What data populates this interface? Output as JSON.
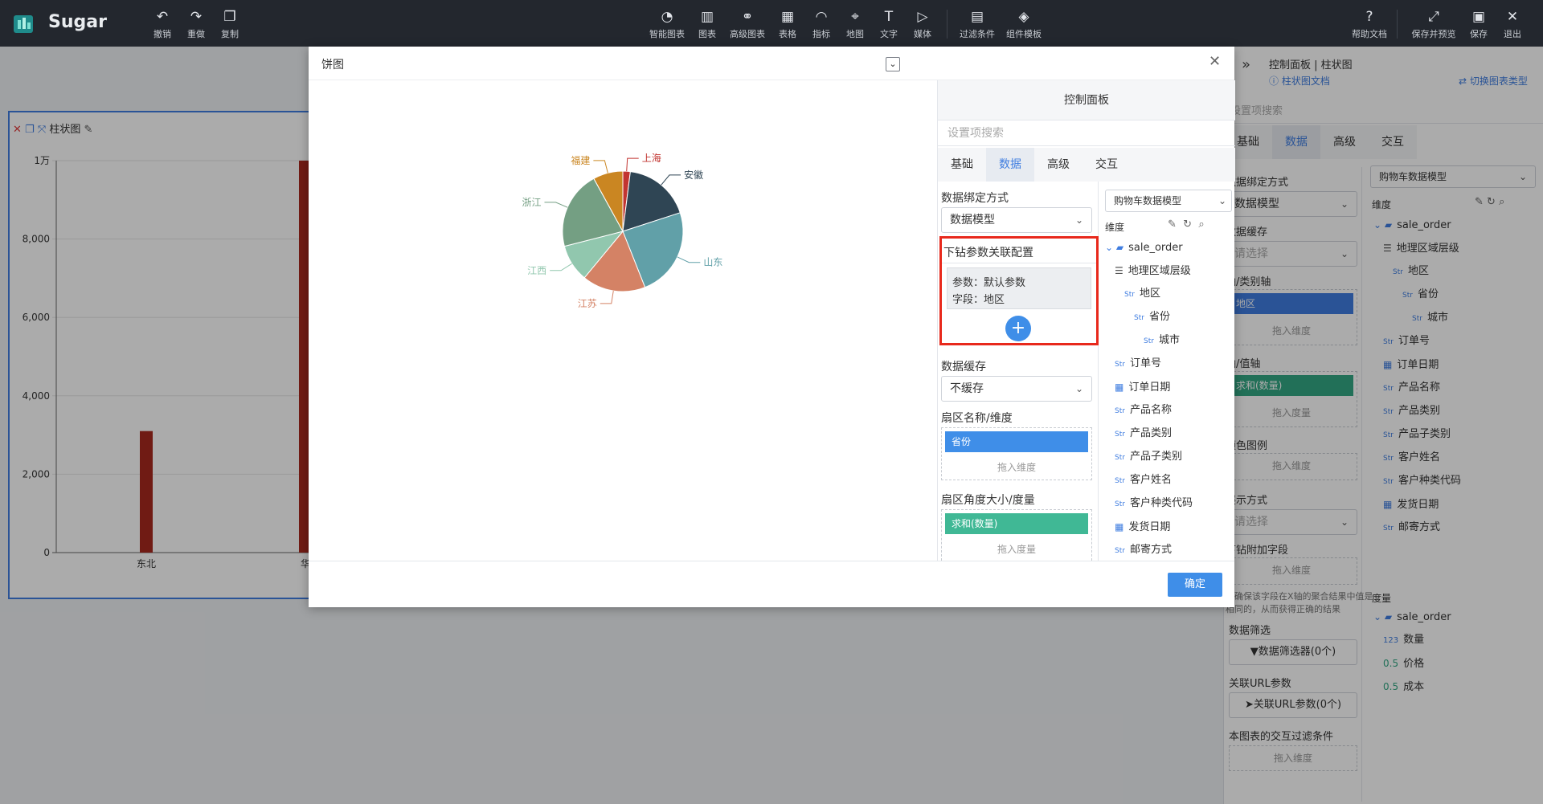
{
  "app": {
    "title": "Sugar"
  },
  "toolbar": {
    "left": [
      {
        "label": "撤销",
        "icon": "undo-icon"
      },
      {
        "label": "重做",
        "icon": "redo-icon"
      },
      {
        "label": "复制",
        "icon": "copy-icon"
      }
    ],
    "center": [
      {
        "label": "智能图表"
      },
      {
        "label": "图表"
      },
      {
        "label": "高级图表"
      },
      {
        "label": "表格"
      },
      {
        "label": "指标"
      },
      {
        "label": "地图"
      },
      {
        "label": "文字"
      },
      {
        "label": "媒体"
      },
      {
        "label": "过滤条件"
      },
      {
        "label": "组件模板"
      }
    ],
    "right": [
      {
        "label": "帮助文档"
      },
      {
        "label": "保存并预览"
      },
      {
        "label": "保存"
      },
      {
        "label": "退出"
      }
    ]
  },
  "bg_chart": {
    "title": "柱状图",
    "chart_data": {
      "type": "bar",
      "categories": [
        "东北",
        "华"
      ],
      "values": [
        3100,
        10000
      ],
      "yticks": [
        "1万",
        "8,000",
        "6,000",
        "4,000",
        "2,000",
        "0"
      ],
      "ylim": [
        0,
        10000
      ]
    }
  },
  "modal": {
    "title": "饼图",
    "confirm_label": "确定",
    "pie_chart": {
      "chart_data": {
        "type": "pie",
        "slices": [
          {
            "name": "上海",
            "value": 2,
            "color": "#c23531"
          },
          {
            "name": "安徽",
            "value": 18,
            "color": "#2f4554"
          },
          {
            "name": "山东",
            "value": 24,
            "color": "#61a0a8"
          },
          {
            "name": "江苏",
            "value": 17,
            "color": "#d48265"
          },
          {
            "name": "江西",
            "value": 10,
            "color": "#91c7ae"
          },
          {
            "name": "浙江",
            "value": 21,
            "color": "#749f83"
          },
          {
            "name": "福建",
            "value": 8,
            "color": "#ca8622"
          }
        ]
      }
    },
    "panel": {
      "title": "控制面板",
      "search_placeholder": "设置项搜索",
      "tabs": [
        "基础",
        "数据",
        "高级",
        "交互"
      ],
      "binding_label": "数据绑定方式",
      "binding_value": "数据模型",
      "drill_title": "下钻参数关联配置",
      "drill_param": "参数：默认参数",
      "drill_field": "字段：地区",
      "cache_label": "数据缓存",
      "cache_value": "不缓存",
      "dim_label": "扇区名称/维度",
      "dim_pill": "省份",
      "dim_drop": "拖入维度",
      "measure_label": "扇区角度大小/度量",
      "measure_pill": "求和(数量)",
      "measure_drop": "拖入度量",
      "model_select": "购物车数据模型",
      "dim_section": "维度",
      "tree": [
        {
          "label": "sale_order",
          "type": "folder",
          "indent": 0
        },
        {
          "label": "地理区域层级",
          "type": "hier",
          "indent": 1
        },
        {
          "label": "地区",
          "type": "str",
          "indent": 2
        },
        {
          "label": "省份",
          "type": "str",
          "indent": 3
        },
        {
          "label": "城市",
          "type": "str",
          "indent": 4
        },
        {
          "label": "订单号",
          "type": "str",
          "indent": 1
        },
        {
          "label": "订单日期",
          "type": "date",
          "indent": 1
        },
        {
          "label": "产品名称",
          "type": "str",
          "indent": 1
        },
        {
          "label": "产品类别",
          "type": "str",
          "indent": 1
        },
        {
          "label": "产品子类别",
          "type": "str",
          "indent": 1
        },
        {
          "label": "客户姓名",
          "type": "str",
          "indent": 1
        },
        {
          "label": "客户种类代码",
          "type": "str",
          "indent": 1
        },
        {
          "label": "发货日期",
          "type": "date",
          "indent": 1
        },
        {
          "label": "邮寄方式",
          "type": "str",
          "indent": 1
        }
      ]
    }
  },
  "right_panel": {
    "header": "控制面板 | 柱状图",
    "doc_link": "柱状图文档",
    "switch_link": "切换图表类型",
    "search_placeholder": "设置项搜索",
    "tabs": [
      "基础",
      "数据",
      "高级",
      "交互"
    ],
    "binding_label": "数据绑定方式",
    "binding_value": "数据模型",
    "cache_label": "数据缓存",
    "cache_value": "请选择",
    "xaxis_label": "轴/类别轴",
    "xaxis_pill": "地区",
    "xaxis_drop": "拖入维度",
    "yaxis_label": "轴/值轴",
    "yaxis_pill": "求和(数量)",
    "yaxis_drop": "拖入度量",
    "color_label": "颜色图例",
    "color_drop": "拖入维度",
    "display_label": "展示方式",
    "display_value": "请选择",
    "drill_label": "下钻附加字段",
    "drill_drop": "拖入维度",
    "note_1": "请确保该字段在X轴的聚合结果中值是",
    "note_2": "相同的，从而获得正确的结果",
    "filter_label": "数据筛选",
    "filter_button": "数据筛选器(0个)",
    "url_label": "关联URL参数",
    "url_button": "关联URL参数(0个)",
    "interact_label": "本图表的交互过滤条件",
    "interact_drop": "拖入维度",
    "model_select": "购物车数据模型",
    "dim_section": "维度",
    "measure_section": "度量",
    "dim_tree": [
      {
        "label": "sale_order",
        "type": "folder",
        "indent": 0
      },
      {
        "label": "地理区域层级",
        "type": "hier",
        "indent": 1
      },
      {
        "label": "地区",
        "type": "str",
        "indent": 2
      },
      {
        "label": "省份",
        "type": "str",
        "indent": 3
      },
      {
        "label": "城市",
        "type": "str",
        "indent": 4
      },
      {
        "label": "订单号",
        "type": "str",
        "indent": 1
      },
      {
        "label": "订单日期",
        "type": "date",
        "indent": 1
      },
      {
        "label": "产品名称",
        "type": "str",
        "indent": 1
      },
      {
        "label": "产品类别",
        "type": "str",
        "indent": 1
      },
      {
        "label": "产品子类别",
        "type": "str",
        "indent": 1
      },
      {
        "label": "客户姓名",
        "type": "str",
        "indent": 1
      },
      {
        "label": "客户种类代码",
        "type": "str",
        "indent": 1
      },
      {
        "label": "发货日期",
        "type": "date",
        "indent": 1
      },
      {
        "label": "邮寄方式",
        "type": "str",
        "indent": 1
      }
    ],
    "measure_tree": [
      {
        "label": "sale_order",
        "type": "folder",
        "indent": 0
      },
      {
        "label": "数量",
        "type": "num",
        "indent": 1
      },
      {
        "label": "价格",
        "type": "dec",
        "indent": 1
      },
      {
        "label": "成本",
        "type": "dec",
        "indent": 1
      }
    ]
  }
}
